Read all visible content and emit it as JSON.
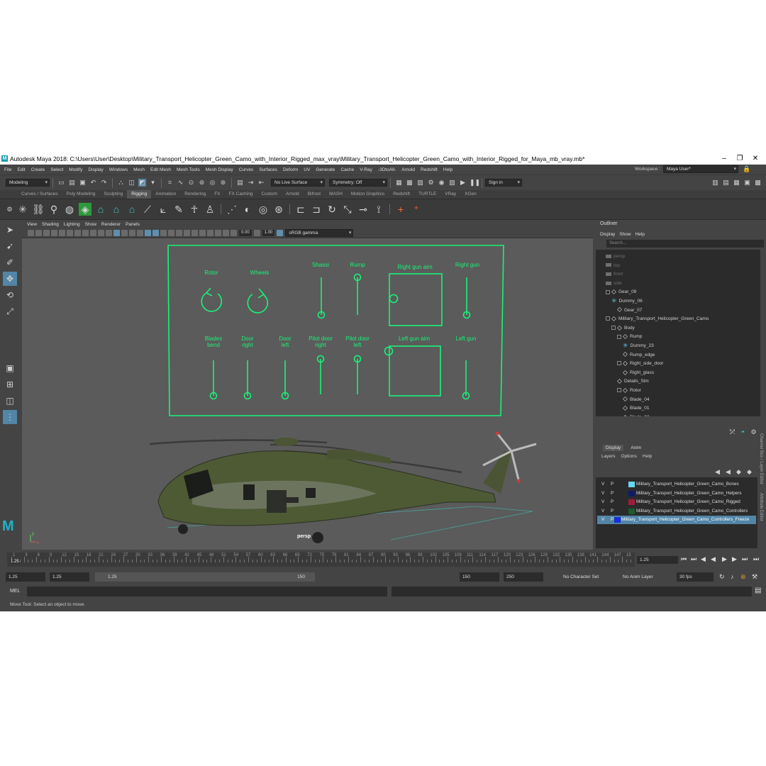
{
  "title": "Autodesk Maya 2018: C:\\Users\\User\\Desktop\\Military_Transport_Helicopter_Green_Camo_with_Interior_Rigged_max_vray\\Military_Transport_Helicopter_Green_Camo_with_Interior_Rigged_for_Maya_mb_vray.mb*",
  "menu": [
    "File",
    "Edit",
    "Create",
    "Select",
    "Modify",
    "Display",
    "Windows",
    "Mesh",
    "Edit Mesh",
    "Mesh Tools",
    "Mesh Display",
    "Curves",
    "Surfaces",
    "Deform",
    "UV",
    "Generate",
    "Cache",
    "V-Ray",
    "-3DtoAll-",
    "Arnold",
    "Redshift",
    "Help"
  ],
  "workspace": {
    "label": "Workspace :",
    "value": "Maya User*"
  },
  "status": {
    "mode": "Modeling",
    "live_surface": "No Live Surface",
    "symmetry": "Symmetry: Off",
    "sign_in": "Sign in"
  },
  "shelf_tabs": [
    "Curves / Surfaces",
    "Poly Modeling",
    "Sculpting",
    "Rigging",
    "Animation",
    "Rendering",
    "FX",
    "FX Caching",
    "Custom",
    "Arnold",
    "Bifrost",
    "MASH",
    "Motion Graphics",
    "Redshift",
    "TURTLE",
    "VRay",
    "XGen"
  ],
  "viewport": {
    "menu": [
      "View",
      "Shading",
      "Lighting",
      "Show",
      "Renderer",
      "Panels"
    ],
    "value_a": "0.00",
    "value_b": "1.00",
    "color_space": "sRGB gamma",
    "camera_label": "persp",
    "controls": {
      "rotor": "Rotor",
      "wheels": "Wheels",
      "shassi": "Shassi",
      "rump": "Rump",
      "right_gun_aim": "Right gun aim",
      "right_gun": "Right gun",
      "blades_bend_1": "Blades",
      "blades_bend_2": "bend",
      "door_right_1": "Door",
      "door_right_2": "right",
      "door_left_1": "Door",
      "door_left_2": "left",
      "pilot_door_right_1": "Pilot door",
      "pilot_door_right_2": "right",
      "pilot_door_left_1": "Pilot door",
      "pilot_door_left_2": "left",
      "left_gun_aim": "Left gun aim",
      "left_gun": "Left gun"
    }
  },
  "outliner": {
    "title": "Outliner",
    "menu": [
      "Display",
      "Show",
      "Help"
    ],
    "search_placeholder": "Search...",
    "items": [
      {
        "label": "persp",
        "depth": 1,
        "dim": true,
        "icon": "camera"
      },
      {
        "label": "top",
        "depth": 1,
        "dim": true,
        "icon": "camera"
      },
      {
        "label": "front",
        "depth": 1,
        "dim": true,
        "icon": "camera"
      },
      {
        "label": "side",
        "depth": 1,
        "dim": true,
        "icon": "camera"
      },
      {
        "label": "Gear_09",
        "depth": 1,
        "icon": "transform",
        "exp": true
      },
      {
        "label": "Dummy_06",
        "depth": 2,
        "icon": "locator"
      },
      {
        "label": "Gear_07",
        "depth": 3,
        "icon": "transform"
      },
      {
        "label": "Military_Transport_Helicopter_Green_Camo",
        "depth": 1,
        "icon": "transform",
        "exp": true
      },
      {
        "label": "Body",
        "depth": 2,
        "icon": "transform",
        "exp": true
      },
      {
        "label": "Rump",
        "depth": 3,
        "icon": "transform",
        "exp": true
      },
      {
        "label": "Dummy_23",
        "depth": 4,
        "icon": "locator"
      },
      {
        "label": "Rump_edge",
        "depth": 4,
        "icon": "transform"
      },
      {
        "label": "Right_side_door",
        "depth": 3,
        "icon": "transform",
        "exp": true
      },
      {
        "label": "Right_glass",
        "depth": 4,
        "icon": "transform"
      },
      {
        "label": "Details_Sim",
        "depth": 3,
        "icon": "transform"
      },
      {
        "label": "Rotor",
        "depth": 3,
        "icon": "transform",
        "exp": true
      },
      {
        "label": "Blade_04",
        "depth": 4,
        "icon": "transform"
      },
      {
        "label": "Blade_01",
        "depth": 4,
        "icon": "transform"
      },
      {
        "label": "Blade_02",
        "depth": 4,
        "icon": "transform"
      }
    ]
  },
  "layers": {
    "tabs": [
      "Display",
      "Anim"
    ],
    "menu": [
      "Layers",
      "Options",
      "Help"
    ],
    "items": [
      {
        "v": "V",
        "p": "P",
        "name": "Military_Transport_Helicopter_Green_Camo_Bones",
        "color": "#66d8f0"
      },
      {
        "v": "V",
        "p": "P",
        "name": "Military_Transport_Helicopter_Green_Camo_Helpers",
        "color": "#101a6a"
      },
      {
        "v": "V",
        "p": "P",
        "name": "Military_Transport_Helicopter_Green_Camo_Rigged",
        "color": "#a01c3c"
      },
      {
        "v": "V",
        "p": "P",
        "name": "Military_Transport_Helicopter_Green_Camo_Controllers",
        "color": "#1e5a30"
      },
      {
        "v": "V",
        "p": "P",
        "name": "Military_Transport_Helicopter_Green_Camo_Controllers_Freeze",
        "color": "#1a2ed8",
        "selected": true
      }
    ],
    "side_tabs": [
      "Channel Box / Layer Editor",
      "Attribute Editor"
    ]
  },
  "timeline": {
    "ticks": [
      "1",
      "3",
      "6",
      "9",
      "12",
      "15",
      "18",
      "21",
      "24",
      "27",
      "30",
      "33",
      "36",
      "39",
      "42",
      "45",
      "48",
      "51",
      "54",
      "57",
      "60",
      "63",
      "66",
      "69",
      "72",
      "75",
      "78",
      "81",
      "84",
      "87",
      "90",
      "93",
      "96",
      "99",
      "102",
      "105",
      "108",
      "111",
      "114",
      "117",
      "120",
      "123",
      "126",
      "129",
      "132",
      "135",
      "138",
      "141",
      "144",
      "147",
      "15"
    ],
    "current_frame": "1.25",
    "current_marker": "1.25"
  },
  "range": {
    "start": "1.25",
    "anim_start": "1.25",
    "slider_start": "1.25",
    "slider_end": "150",
    "end": "150",
    "anim_end": "250",
    "character_set": "No Character Set",
    "anim_layer": "No Anim Layer",
    "fps": "30 fps"
  },
  "cmd": {
    "label": "MEL"
  },
  "help_line": "Move Tool: Select an object to move.",
  "colors": {
    "control_green": "#19f27a",
    "selection_blue": "#5285a6"
  }
}
